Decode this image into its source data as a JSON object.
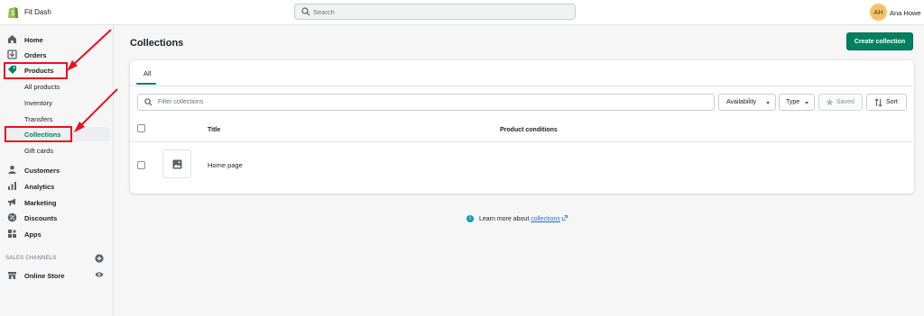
{
  "header": {
    "store_name": "Fit Dash",
    "search_placeholder": "Search",
    "user_initials": "AH",
    "user_name": "Ana Howe"
  },
  "sidebar": {
    "items": [
      {
        "label": "Home",
        "icon": "home-icon"
      },
      {
        "label": "Orders",
        "icon": "orders-icon"
      },
      {
        "label": "Products",
        "icon": "tag-icon"
      },
      {
        "label": "Customers",
        "icon": "person-icon"
      },
      {
        "label": "Analytics",
        "icon": "bar-chart-icon"
      },
      {
        "label": "Marketing",
        "icon": "megaphone-icon"
      },
      {
        "label": "Discounts",
        "icon": "discount-icon"
      },
      {
        "label": "Apps",
        "icon": "apps-icon"
      }
    ],
    "product_subitems": [
      "All products",
      "Inventory",
      "Transfers",
      "Collections",
      "Gift cards"
    ],
    "active_subitem": "Collections",
    "channels_title": "SALES CHANNELS",
    "channels": [
      {
        "label": "Online Store",
        "icon": "store-icon"
      }
    ]
  },
  "main": {
    "title": "Collections",
    "create_button": "Create collection",
    "tabs": [
      "All"
    ],
    "filter_placeholder": "Filter collections",
    "filters": {
      "availability": "Availability",
      "type": "Type",
      "saved": "Saved",
      "sort": "Sort"
    },
    "columns": {
      "title": "Title",
      "conditions": "Product conditions"
    },
    "rows": [
      {
        "title": "Home page",
        "conditions": ""
      }
    ],
    "learn_prefix": "Learn more about",
    "learn_link": "collections"
  },
  "colors": {
    "accent": "#008060",
    "annotation": "#e8111d",
    "link": "#2c6ecb"
  }
}
